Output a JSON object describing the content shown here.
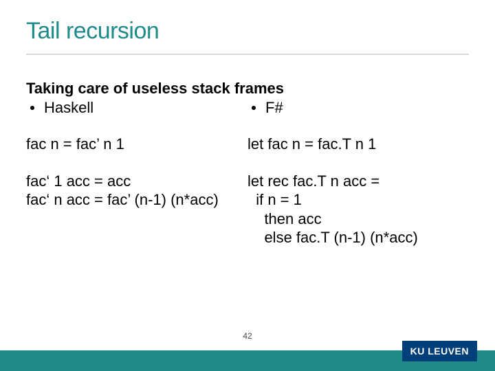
{
  "title": "Tail recursion",
  "subtitle": "Taking care of useless stack frames",
  "left": {
    "bullet": "Haskell",
    "line1": "fac n = fac’ n 1",
    "block": "fac‘ 1 acc = acc\nfac‘ n acc = fac’ (n-1) (n*acc)"
  },
  "right": {
    "bullet": "F#",
    "line1": "let fac n = fac.T n 1",
    "block": "let rec fac.T n acc =\n  if n = 1\n    then acc\n    else fac.T (n-1) (n*acc)"
  },
  "page_number": "42",
  "brand": "KU LEUVEN",
  "colors": {
    "accent": "#1f8a8a",
    "brand_bg": "#00407a"
  }
}
